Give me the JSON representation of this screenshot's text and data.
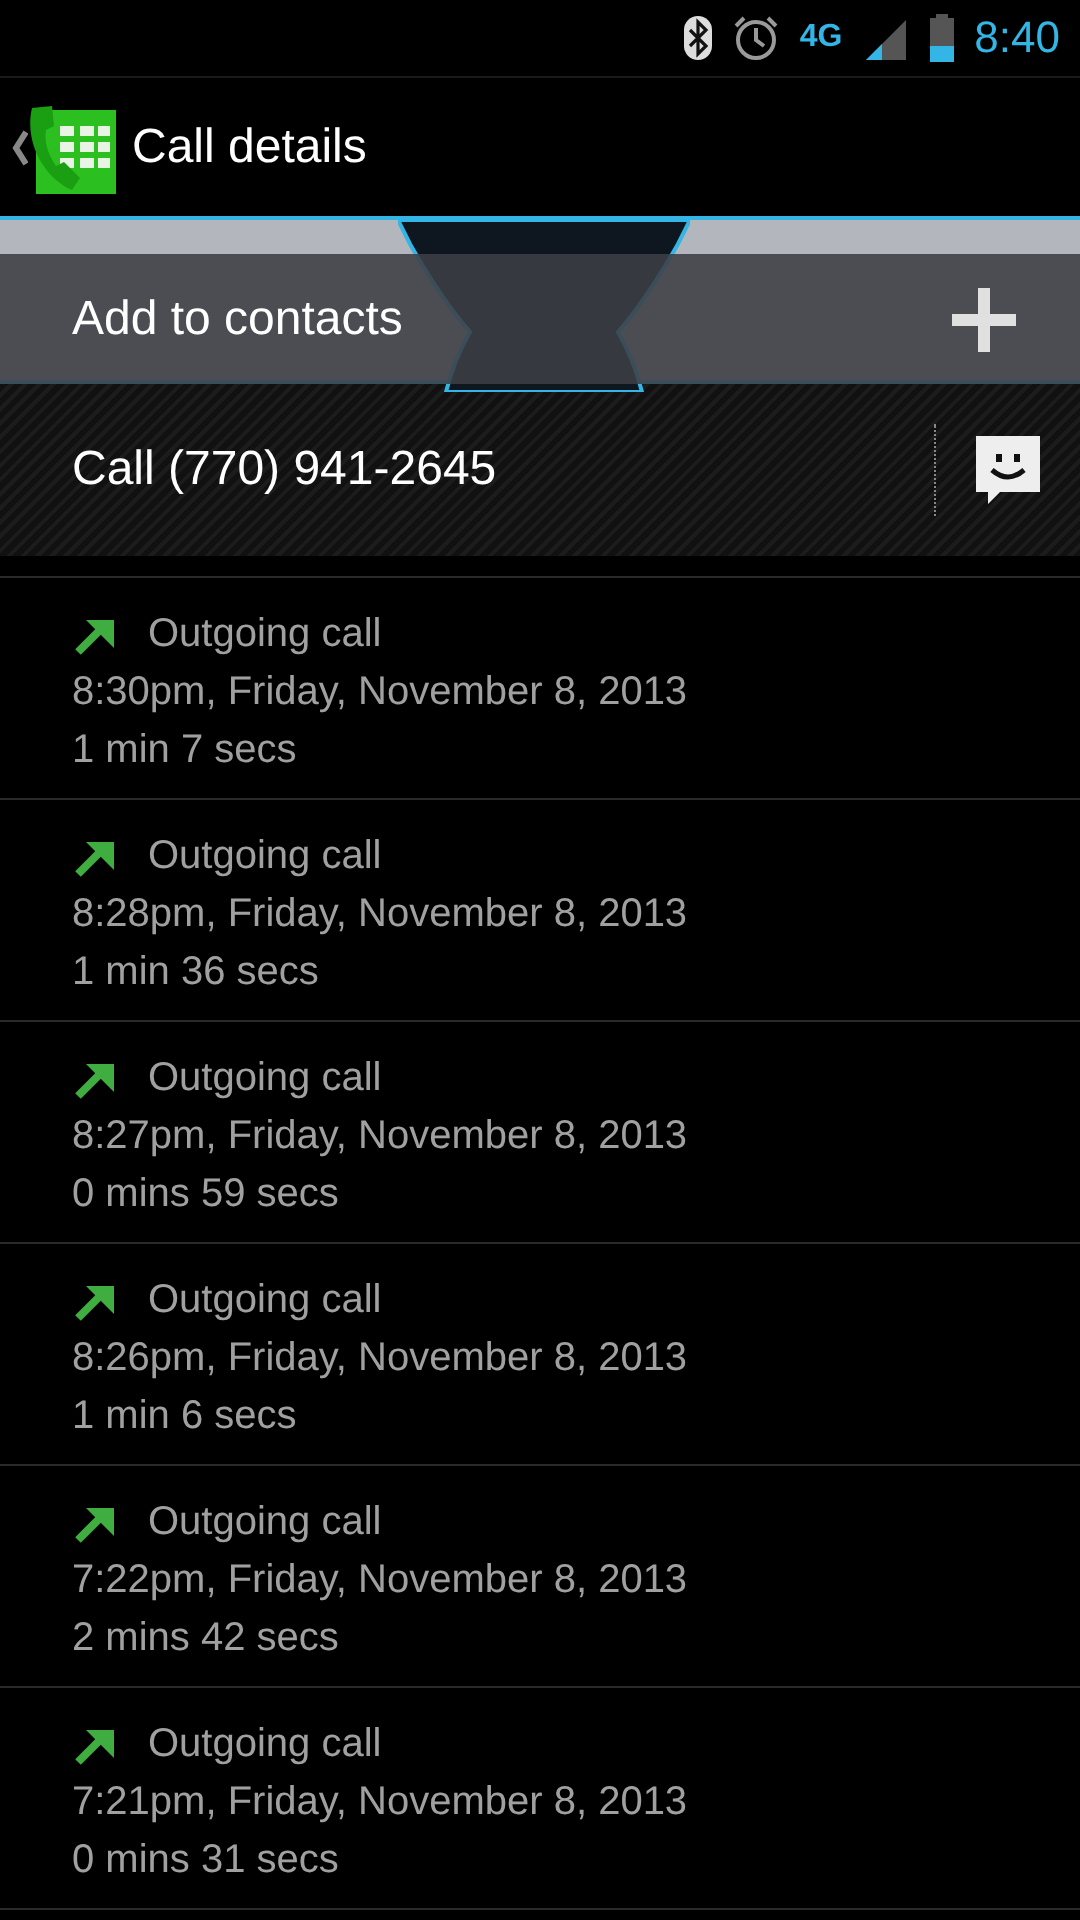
{
  "status_bar": {
    "time": "8:40",
    "network": "4G"
  },
  "action_bar": {
    "title": "Call details"
  },
  "contact": {
    "action": "Add to contacts"
  },
  "call_row": {
    "label": "Call (770) 941-2645"
  },
  "calls": [
    {
      "kind": "outgoing",
      "type": "Outgoing call",
      "time": "8:30pm, Friday, November 8, 2013",
      "duration": "1 min 7 secs"
    },
    {
      "kind": "outgoing",
      "type": "Outgoing call",
      "time": "8:28pm, Friday, November 8, 2013",
      "duration": "1 min 36 secs"
    },
    {
      "kind": "outgoing",
      "type": "Outgoing call",
      "time": "8:27pm, Friday, November 8, 2013",
      "duration": "0 mins 59 secs"
    },
    {
      "kind": "outgoing",
      "type": "Outgoing call",
      "time": "8:26pm, Friday, November 8, 2013",
      "duration": "1 min 6 secs"
    },
    {
      "kind": "outgoing",
      "type": "Outgoing call",
      "time": "7:22pm, Friday, November 8, 2013",
      "duration": "2 mins 42 secs"
    },
    {
      "kind": "outgoing",
      "type": "Outgoing call",
      "time": "7:21pm, Friday, November 8, 2013",
      "duration": "0 mins 31 secs"
    }
  ]
}
